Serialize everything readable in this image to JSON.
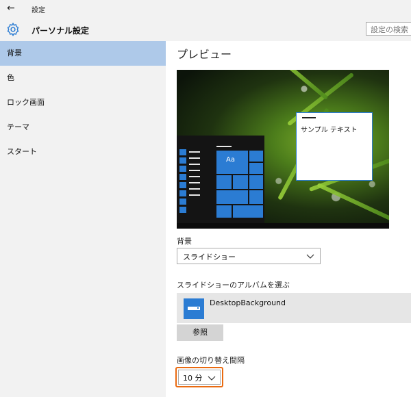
{
  "window": {
    "title": "設定",
    "back_glyph": "←"
  },
  "header": {
    "title": "パーソナル設定",
    "search_placeholder": "設定の検索"
  },
  "sidebar": {
    "items": [
      {
        "label": "背景"
      },
      {
        "label": "色"
      },
      {
        "label": "ロック画面"
      },
      {
        "label": "テーマ"
      },
      {
        "label": "スタート"
      }
    ]
  },
  "main": {
    "preview_heading": "プレビュー",
    "preview": {
      "tile_label": "Aa",
      "sample_text": "サンプル テキスト"
    },
    "background_label": "背景",
    "background_value": "スライドショー",
    "album_label": "スライドショーのアルバムを選ぶ",
    "album_name": "DesktopBackground",
    "browse_label": "参照",
    "interval_label": "画像の切り替え間隔",
    "interval_value": "10 分"
  },
  "colors": {
    "accent": "#2b7cd3",
    "selected_item": "#aec9e9",
    "highlight_box": "#ea6a10"
  }
}
